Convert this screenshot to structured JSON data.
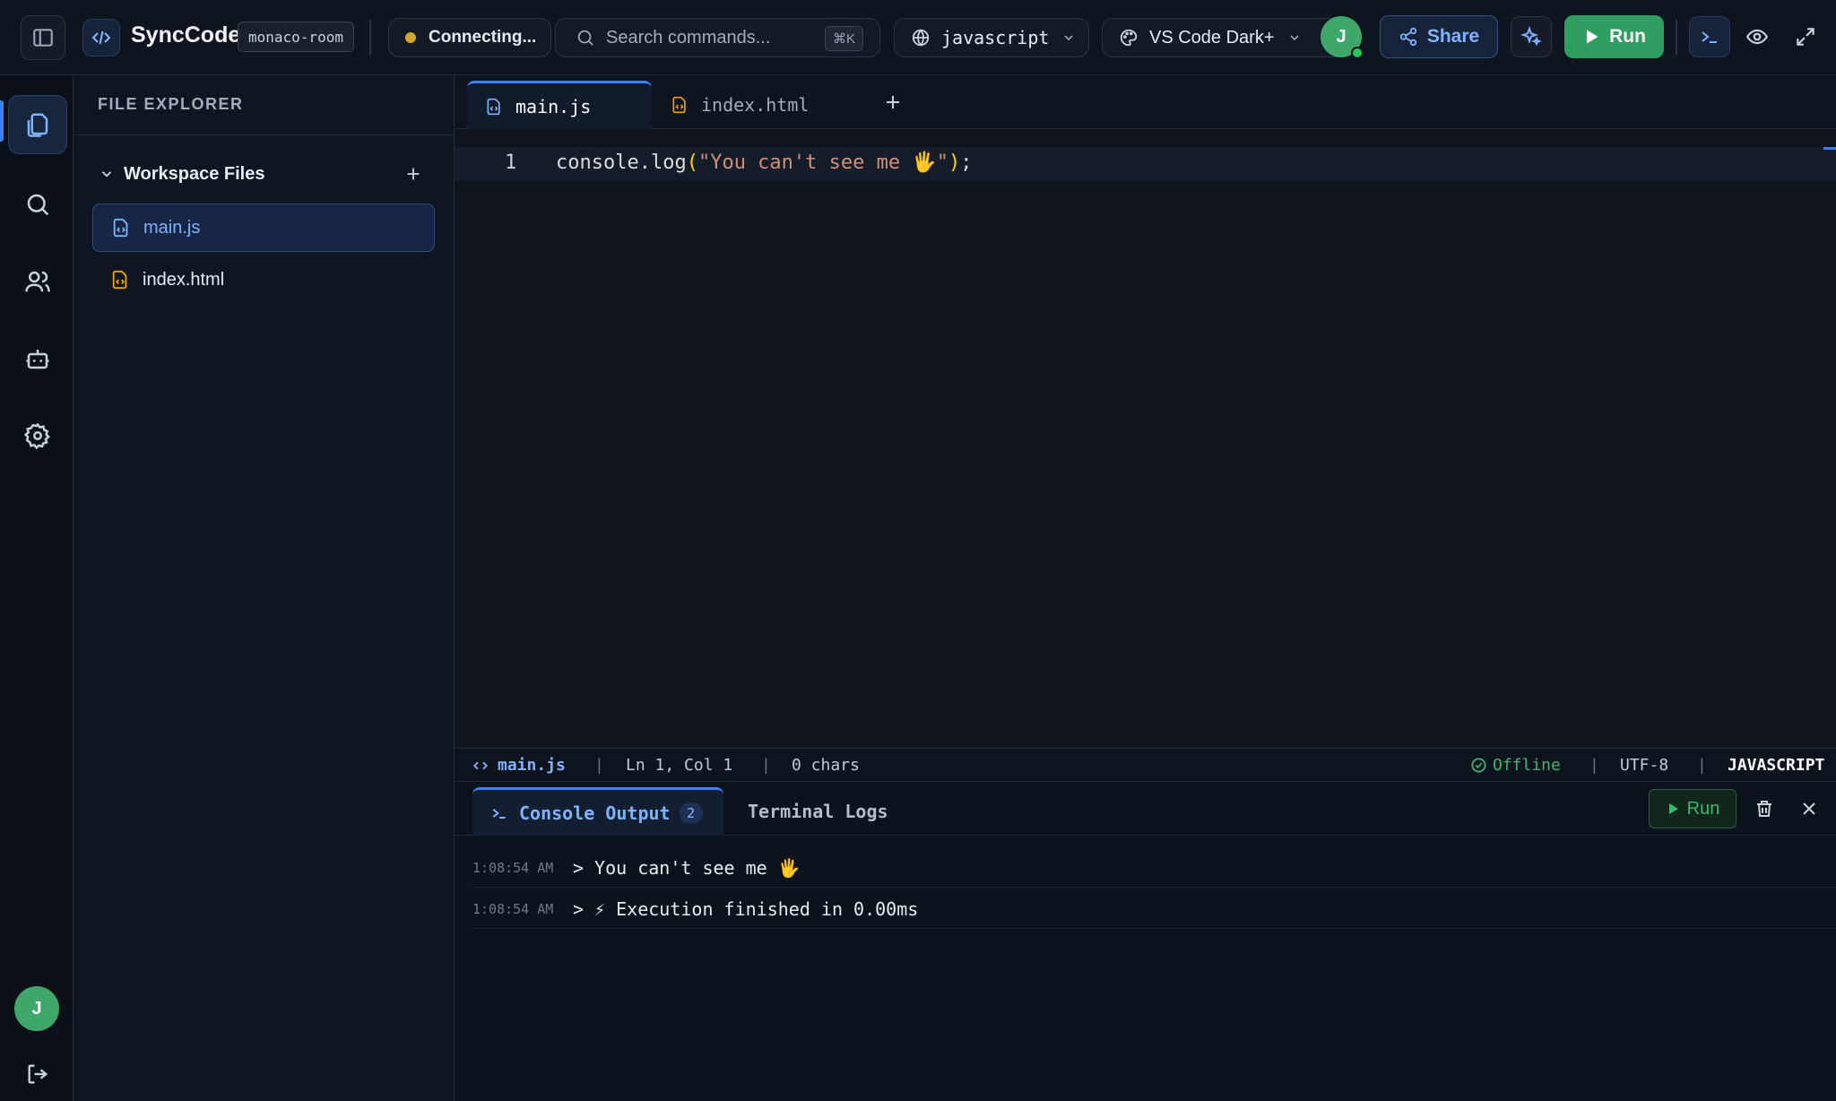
{
  "app": {
    "name": "SyncCode",
    "room": "monaco-room"
  },
  "topbar": {
    "connection_status": "Connecting...",
    "search_placeholder": "Search commands...",
    "search_shortcut": "⌘K",
    "language": "javascript",
    "theme": "VS Code Dark+",
    "user_initial": "J",
    "share_label": "Share",
    "run_label": "Run"
  },
  "sidebar": {
    "title": "FILE EXPLORER",
    "workspace_label": "Workspace Files",
    "files": [
      {
        "name": "main.js",
        "active": true
      },
      {
        "name": "index.html",
        "active": false
      }
    ],
    "user_initial": "J"
  },
  "editor": {
    "tabs": [
      {
        "label": "main.js",
        "active": true
      },
      {
        "label": "index.html",
        "active": false
      }
    ],
    "lines": [
      {
        "number": "1",
        "tokens": {
          "fn": "console.log",
          "open": "(",
          "str": "\"You can't see me 🖐\"",
          "close": ")",
          "end": ";"
        }
      }
    ]
  },
  "statusbar": {
    "file": "main.js",
    "position": "Ln 1, Col 1",
    "chars": "0 chars",
    "connection": "Offline",
    "encoding": "UTF-8",
    "language": "JAVASCRIPT"
  },
  "console": {
    "tabs": [
      {
        "label": "Console Output",
        "count": "2",
        "active": true
      },
      {
        "label": "Terminal Logs",
        "active": false
      }
    ],
    "run_label": "Run",
    "logs": [
      {
        "time": "1:08:54 AM",
        "prompt": ">",
        "text": "You can't see me 🖐"
      },
      {
        "time": "1:08:54 AM",
        "prompt": ">",
        "text": "⚡ Execution finished in 0.00ms"
      }
    ]
  },
  "colors": {
    "accent": "#3b82f6",
    "run_green": "#2f9e60",
    "status_connecting": "#d4a72c",
    "status_offline": "#3fb772"
  }
}
